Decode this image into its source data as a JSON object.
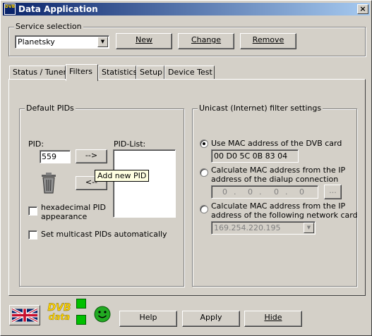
{
  "window": {
    "title": "Data Application",
    "close_glyph": "×",
    "app_icon_text": "DVB"
  },
  "service": {
    "group_label": "Service selection",
    "selected": "Planetsky",
    "new_label": "New",
    "change_label": "Change",
    "remove_label": "Remove"
  },
  "tabs": [
    {
      "label": "Status / Tuner"
    },
    {
      "label": "Filters"
    },
    {
      "label": "Statistics"
    },
    {
      "label": "Setup"
    },
    {
      "label": "Device Test"
    }
  ],
  "default_pids": {
    "group_label": "Default PIDs",
    "pid_label": "PID:",
    "pid_value": "559",
    "list_label": "PID-List:",
    "add_button": "-->",
    "remove_button": "<--",
    "tooltip": "Add new PID",
    "hex_label_1": "hexadecimal PID",
    "hex_label_2": "appearance",
    "multicast_label": "Set multicast PIDs automatically"
  },
  "unicast": {
    "group_label": "Unicast (Internet) filter settings",
    "opt1_label": "Use MAC address of the DVB card",
    "mac_value": "00 D0 5C 0B 83 04",
    "opt2_label_1": "Calculate MAC address from the IP",
    "opt2_label_2": "address of the dialup connection",
    "ip_parts": [
      "0",
      "0",
      "0",
      "0"
    ],
    "browse_label": "...",
    "opt3_label_1": "Calculate MAC address from the IP",
    "opt3_label_2": "address of the following network card",
    "network_card": "169.254.220.195"
  },
  "footer": {
    "help_label": "Help",
    "apply_label": "Apply",
    "hide_label": "Hide",
    "logo_top": "DVB",
    "logo_bottom": "data"
  },
  "colors": {
    "title_start": "#0a246a",
    "title_end": "#a6caf0",
    "led_green": "#00c000",
    "smiley": "#22aa22"
  }
}
